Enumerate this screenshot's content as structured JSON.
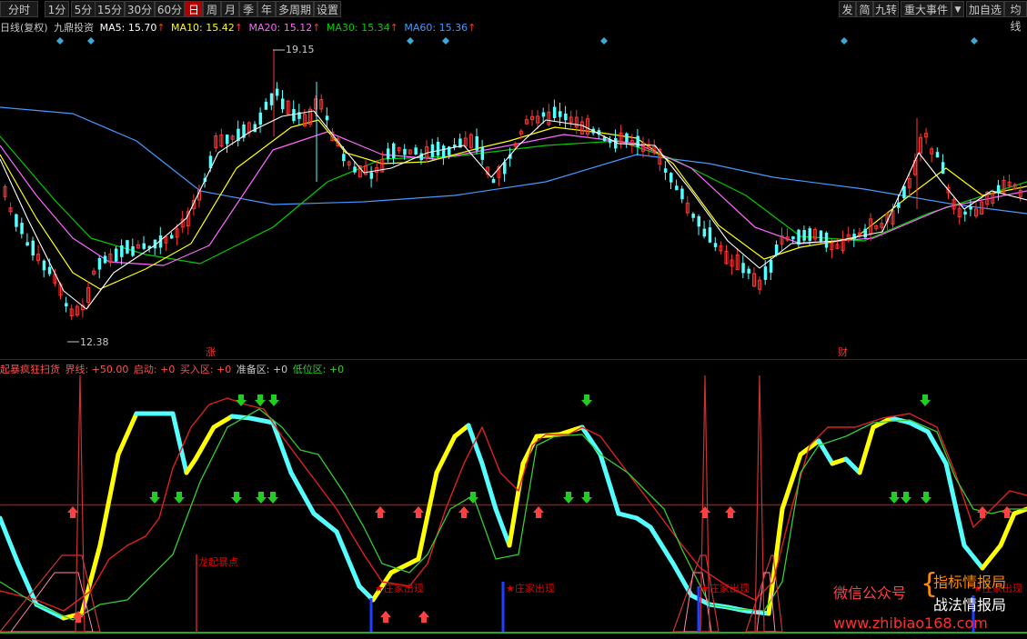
{
  "toolbar": {
    "left": [
      "分时",
      "1分",
      "5分",
      "15分",
      "30分",
      "60分",
      "日",
      "周",
      "月",
      "季",
      "年",
      "多周期",
      "设置"
    ],
    "active": "日",
    "right": [
      "发",
      "简",
      "九转",
      "重大事件",
      "▼",
      "加自选",
      "均线"
    ]
  },
  "main_header": {
    "period": "日线(复权)",
    "name": "九鼎投资",
    "ma5_label": "MA5:",
    "ma5_value": "15.70",
    "ma10_label": "MA10:",
    "ma10_value": "15.42",
    "ma20_label": "MA20:",
    "ma20_value": "15.12",
    "ma30_label": "MA30:",
    "ma30_value": "15.34",
    "ma60_label": "MA60:",
    "ma60_value": "15.36",
    "arrow": "↑"
  },
  "price_high_label": "19.15",
  "price_low_label": "12.38",
  "event_mark_1": "涨",
  "event_mark_2": "财",
  "indicator_header": {
    "name": "起暴疯狂扫货",
    "jiexian": "界线: +50.00",
    "qidong": "启动: +0",
    "mairu": "买入区: +0",
    "zhunbei": "准备区: +0",
    "diwei": "低位区: +0"
  },
  "annotations": {
    "long_start": "龙起暴点",
    "zhuang": "庄家出现",
    "star": "★"
  },
  "watermark": {
    "wechat": "微信公众号",
    "line1": "指标情报局",
    "line2": "战法情报局",
    "url": "www.zhibiao168.com"
  },
  "colors": {
    "up": "#ff3232",
    "down": "#54ffff",
    "ma5": "#ffffff",
    "ma10": "#ffff00",
    "ma20": "#ff66ff",
    "ma30": "#00cc00",
    "ma60": "#4499ff",
    "kline": "#ffff00",
    "red_line": "#e02020",
    "green_line": "#33cc33"
  }
}
